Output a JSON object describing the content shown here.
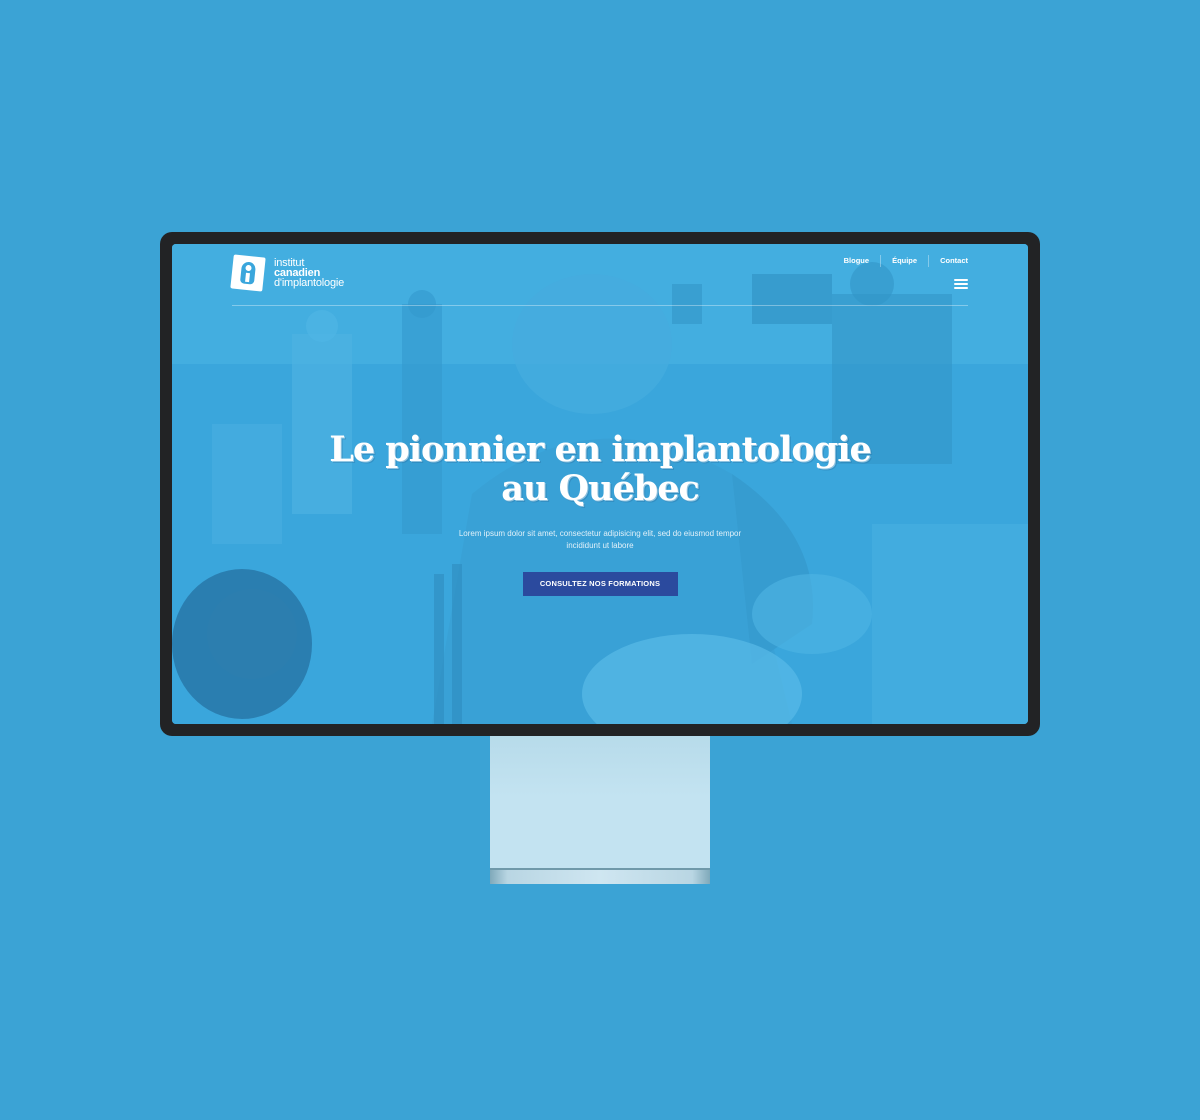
{
  "brand": {
    "line1": "institut",
    "line2": "canadien",
    "line3": "d'implantologie"
  },
  "nav": {
    "items": [
      "Blogue",
      "Équipe",
      "Contact"
    ],
    "menu_icon": "hamburger-menu-icon"
  },
  "hero": {
    "title": "Le pionnier en implantologie au Québec",
    "subtitle": "Lorem ipsum dolor sit amet, consectetur adipisicing elit, sed do eiusmod tempor incididunt ut labore",
    "cta_label": "CONSULTEZ NOS FORMATIONS"
  },
  "colors": {
    "background": "#3ba3d5",
    "screen_tint": "#3aa6dc",
    "cta": "#2b4a9e",
    "bezel": "#222325"
  }
}
